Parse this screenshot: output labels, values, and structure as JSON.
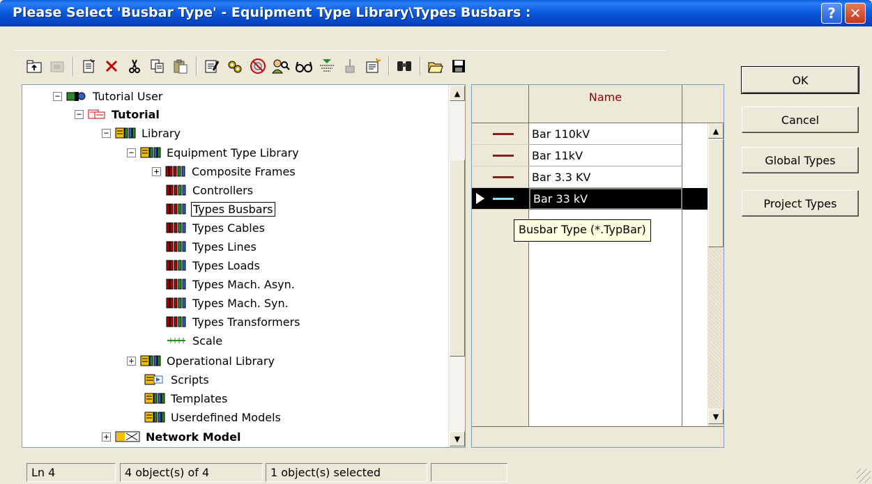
{
  "window": {
    "title": "Please Select 'Busbar Type' - Equipment Type Library\\Types Busbars :",
    "help_label": "?",
    "close_label": "✕"
  },
  "toolbar": {
    "icons": [
      "folder-up-icon",
      "disabled-folder-icon",
      "new-object-icon",
      "delete-icon",
      "cut-icon",
      "copy-icon",
      "paste-icon",
      "edit-icon",
      "settings-gears-icon",
      "disabled-circle-icon",
      "find-user-icon",
      "glasses-icon",
      "filter-icon",
      "sort-icon",
      "new-window-icon",
      "binoculars-icon",
      "open-folder-icon",
      "save-disk-icon"
    ]
  },
  "tree": {
    "nodes": [
      {
        "label": "Tutorial User",
        "expander": "−"
      },
      {
        "label": "Tutorial",
        "expander": "−"
      },
      {
        "label": "Library",
        "expander": "−"
      },
      {
        "label": "Equipment Type Library",
        "expander": "−"
      },
      {
        "label": "Composite Frames",
        "expander": "+"
      },
      {
        "label": "Controllers"
      },
      {
        "label": "Types Busbars"
      },
      {
        "label": "Types Cables"
      },
      {
        "label": "Types Lines"
      },
      {
        "label": "Types Loads"
      },
      {
        "label": "Types Mach. Asyn."
      },
      {
        "label": "Types Mach. Syn."
      },
      {
        "label": "Types Transformers"
      },
      {
        "label": "Scale"
      },
      {
        "label": "Operational Library",
        "expander": "+"
      },
      {
        "label": "Scripts"
      },
      {
        "label": "Templates"
      },
      {
        "label": "Userdefined Models"
      },
      {
        "label": "Network Model",
        "expander": "+"
      }
    ]
  },
  "table": {
    "column_name": "Name",
    "rows": [
      "Bar 110kV",
      "Bar 11kV",
      "Bar 3.3 KV",
      "Bar 33 kV"
    ],
    "selected_row": "Bar 33 kV"
  },
  "tooltip": "Busbar Type (*.TypBar)",
  "buttons": {
    "ok": "OK",
    "cancel": "Cancel",
    "global_types": "Global Types",
    "project_types": "Project Types"
  },
  "status": {
    "line": "Ln 4",
    "objects": "4 object(s) of 4",
    "selected": "1 object(s) selected"
  },
  "colors": {
    "title_bar": "#0a5ddc",
    "dialog_bg": "#ece9d8",
    "busbar_line": "#8b1a1a",
    "selected_line": "#8ee6ff"
  }
}
